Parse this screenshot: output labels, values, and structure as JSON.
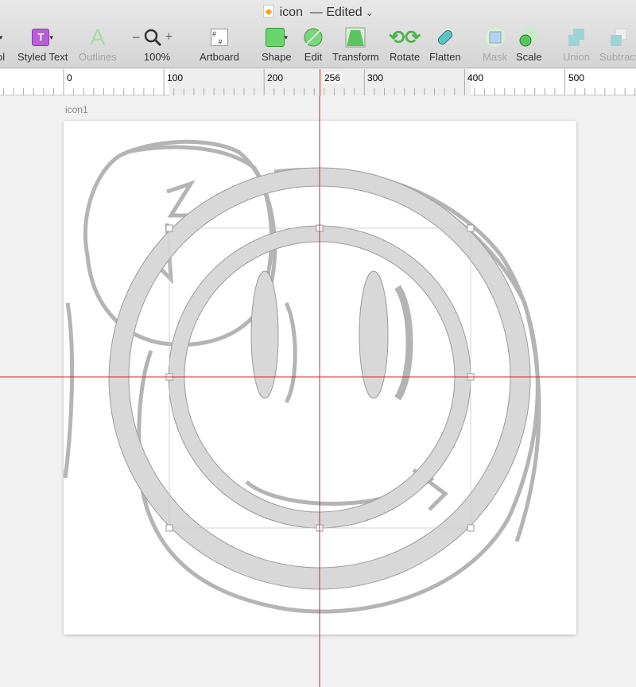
{
  "window": {
    "title": "icon",
    "status": "— Edited"
  },
  "toolbar": {
    "items": [
      {
        "label": "ol",
        "icon": "tool-icon",
        "disabled": false
      },
      {
        "label": "Styled Text",
        "icon": "text-icon",
        "disabled": false
      },
      {
        "label": "Outlines",
        "icon": "outlines-icon",
        "disabled": true
      },
      {
        "label": "100%",
        "icon": "zoom-icon",
        "disabled": false
      },
      {
        "label": "Artboard",
        "icon": "artboard-icon",
        "disabled": false
      },
      {
        "label": "Shape",
        "icon": "shape-icon",
        "disabled": false
      },
      {
        "label": "Edit",
        "icon": "edit-icon",
        "disabled": false
      },
      {
        "label": "Transform",
        "icon": "transform-icon",
        "disabled": false
      },
      {
        "label": "Rotate",
        "icon": "rotate-icon",
        "disabled": false
      },
      {
        "label": "Flatten",
        "icon": "flatten-icon",
        "disabled": false
      },
      {
        "label": "Mask",
        "icon": "mask-icon",
        "disabled": true
      },
      {
        "label": "Scale",
        "icon": "scale-icon",
        "disabled": false
      },
      {
        "label": "Union",
        "icon": "union-icon",
        "disabled": true
      },
      {
        "label": "Subtract",
        "icon": "subtract-icon",
        "disabled": true
      }
    ]
  },
  "ruler": {
    "labels": [
      "0",
      "100",
      "200",
      "256",
      "300",
      "400",
      "500"
    ]
  },
  "artboard": {
    "name": "icon1"
  },
  "colors": {
    "guide": "#e02020",
    "shape_fill": "#d8d8d8",
    "shape_stroke": "#9a9a9a"
  }
}
